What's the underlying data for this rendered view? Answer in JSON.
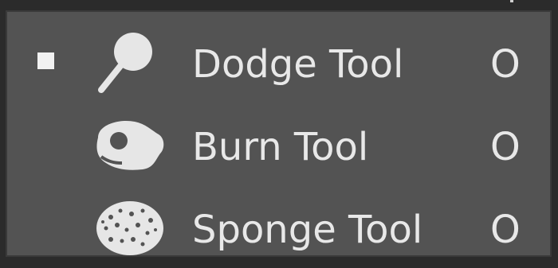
{
  "tool_flyout": {
    "items": [
      {
        "label": "Dodge Tool",
        "shortcut": "O",
        "icon": "dodge-icon",
        "selected": true
      },
      {
        "label": "Burn Tool",
        "shortcut": "O",
        "icon": "burn-icon",
        "selected": false
      },
      {
        "label": "Sponge Tool",
        "shortcut": "O",
        "icon": "sponge-icon",
        "selected": false
      }
    ]
  },
  "colors": {
    "panel_bg": "#535353",
    "text": "#e8e8e8",
    "icon": "#e6e6e6"
  }
}
